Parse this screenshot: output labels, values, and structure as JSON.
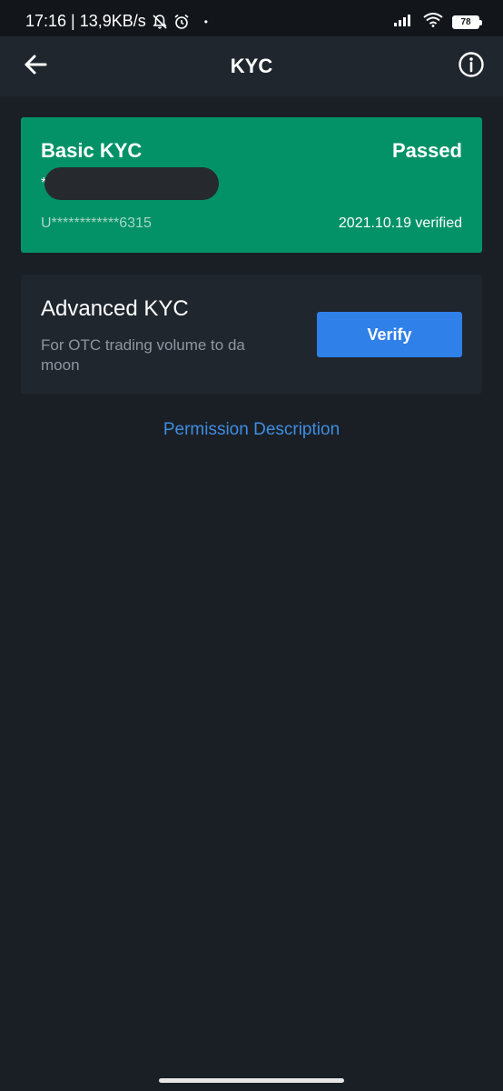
{
  "status_bar": {
    "time_speed": "17:16 | 13,9KB/s",
    "dot": "•",
    "battery": "78"
  },
  "header": {
    "title": "KYC"
  },
  "basic_kyc": {
    "title": "Basic KYC",
    "status": "Passed",
    "name_mask": "*",
    "uid": "U************6315",
    "verified_date": "2021.10.19 verified"
  },
  "advanced_kyc": {
    "title": "Advanced KYC",
    "description": "For OTC trading volume to da moon",
    "verify_label": "Verify"
  },
  "links": {
    "permission_description": "Permission Description"
  },
  "colors": {
    "background": "#1a1f26",
    "card": "#20262e",
    "success_green": "#039267",
    "accent_blue": "#2f80e8",
    "link_blue": "#3f8de0"
  },
  "icons": {
    "back": "arrow-left-icon",
    "info": "info-icon",
    "mute": "bell-off-icon",
    "alarm": "alarm-clock-icon",
    "signal": "signal-icon",
    "wifi": "wifi-icon",
    "battery": "battery-icon"
  }
}
